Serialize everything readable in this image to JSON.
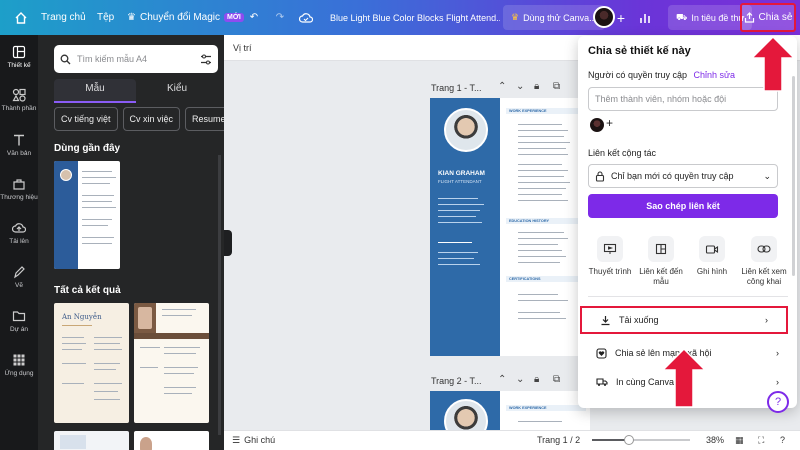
{
  "topbar": {
    "main_label": "Trang chủ",
    "file_label": "Tệp",
    "magic_label": "Chuyển đổi Magic",
    "magic_badge": "MỚI",
    "doc_title": "Blue Light Blue Color Blocks Flight Attend...",
    "try_label": "Dùng thử Canva...",
    "print_label": "In tiêu đề thư",
    "share_label": "Chia sẻ"
  },
  "rail": {
    "items": [
      {
        "label": "Thiết kế",
        "icon": "layout-icon"
      },
      {
        "label": "Thành phần",
        "icon": "shapes-icon"
      },
      {
        "label": "Văn bản",
        "icon": "text-icon"
      },
      {
        "label": "Thương hiệu",
        "icon": "brand-icon"
      },
      {
        "label": "Tải lên",
        "icon": "upload-icon"
      },
      {
        "label": "Vẽ",
        "icon": "draw-icon"
      },
      {
        "label": "Dự án",
        "icon": "folder-icon"
      },
      {
        "label": "Ứng dụng",
        "icon": "apps-icon"
      }
    ]
  },
  "panel": {
    "search_placeholder": "Tìm kiếm mẫu A4",
    "tabs": [
      "Mẫu",
      "Kiểu"
    ],
    "chips": [
      "Cv tiếng việt",
      "Cv xin việc",
      "Resume"
    ],
    "recent_title": "Dùng gần đây",
    "all_results_title": "Tất cả kết quả",
    "thumb_name": "An Nguyễn"
  },
  "canvas": {
    "position_label": "Vị trí",
    "page1_label": "Trang 1 - T...",
    "page2_label": "Trang 2 - T...",
    "resume": {
      "name": "KIAN GRAHAM",
      "job": "FLIGHT ATTENDANT",
      "sections": [
        "WORK EXPERIENCE",
        "EDUCATION HISTORY",
        "CERTIFICATIONS"
      ]
    }
  },
  "statusbar": {
    "notes_label": "Ghi chú",
    "page_indicator": "Trang 1 / 2",
    "zoom": "38%",
    "zoom_fraction": 0.38
  },
  "share": {
    "title": "Chia sẻ thiết kế này",
    "access_label": "Người có quyền truy cập",
    "edit_label": "Chỉnh sửa",
    "add_placeholder": "Thêm thành viên, nhóm hoặc đội",
    "link_label": "Liên kết cộng tác",
    "link_option": "Chỉ bạn mới có quyền truy cập",
    "copy_label": "Sao chép liên kết",
    "options": [
      {
        "label": "Thuyết trình",
        "icon": "present-icon"
      },
      {
        "label": "Liên kết đến mẫu",
        "icon": "template-link-icon"
      },
      {
        "label": "Ghi hình",
        "icon": "record-icon"
      },
      {
        "label": "Liên kết xem công khai",
        "icon": "public-link-icon"
      }
    ],
    "download_label": "Tải xuống",
    "social_label": "Chia sẻ lên mạng xã hội",
    "print_label": "In cùng Canva"
  },
  "colors": {
    "accent": "#7d2ae8",
    "highlight": "#e4183b",
    "resume_blue": "#2e6aa8"
  }
}
